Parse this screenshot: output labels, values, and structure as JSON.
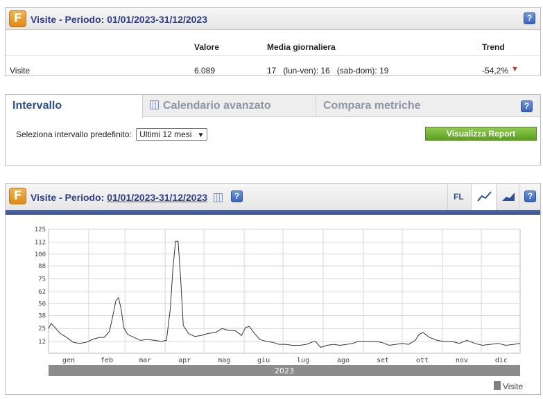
{
  "summary": {
    "logo": "F",
    "title": "Visite - Periodo: 01/01/2023-31/12/2023",
    "help": "?",
    "headers": {
      "valore": "Valore",
      "media": "Media giornaliera",
      "trend": "Trend"
    },
    "row": {
      "label": "Visite",
      "valore": "6.089",
      "media": "17   (lun-ven): 16   (sab-dom): 19",
      "trend": "-54,2%",
      "trend_icon": "down-arrow-icon"
    }
  },
  "interval": {
    "tabs": [
      "Intervallo",
      "Calendario avanzato",
      "Compara metriche"
    ],
    "help": "?",
    "select_label": "Seleziona intervallo predefinito:",
    "select_value": "Ultimi 12 mesi",
    "button": "Visualizza Report"
  },
  "chart_panel": {
    "logo": "F",
    "title_prefix": "Visite - Periodo:",
    "title_period": "01/01/2023-31/12/2023",
    "toolbar": {
      "fl": "FL",
      "line_icon": "line-chart-icon",
      "area_icon": "area-chart-icon",
      "help": "?"
    },
    "colors": {
      "line": "#333333",
      "year_bar": "#8c8c8c",
      "legend": "#808080"
    }
  },
  "chart_data": {
    "type": "line",
    "y_ticks": [
      12,
      25,
      38,
      50,
      62,
      75,
      88,
      100,
      112,
      125
    ],
    "ylim": [
      0,
      125
    ],
    "x_labels": [
      "gen",
      "feb",
      "mar",
      "apr",
      "mag",
      "giu",
      "lug",
      "ago",
      "set",
      "ott",
      "nov",
      "dic"
    ],
    "year_label": "2023",
    "grid": true,
    "legend": "bottom-right",
    "series": [
      {
        "name": "Visite",
        "points": [
          [
            "2023-01-01",
            25
          ],
          [
            "2023-01-03",
            30
          ],
          [
            "2023-01-06",
            26
          ],
          [
            "2023-01-10",
            20
          ],
          [
            "2023-01-15",
            16
          ],
          [
            "2023-01-20",
            11
          ],
          [
            "2023-01-25",
            10
          ],
          [
            "2023-01-30",
            11
          ],
          [
            "2023-02-04",
            14
          ],
          [
            "2023-02-09",
            16
          ],
          [
            "2023-02-13",
            16
          ],
          [
            "2023-02-17",
            22
          ],
          [
            "2023-02-20",
            40
          ],
          [
            "2023-02-22",
            53
          ],
          [
            "2023-02-24",
            56
          ],
          [
            "2023-02-26",
            45
          ],
          [
            "2023-02-28",
            26
          ],
          [
            "2023-03-03",
            19
          ],
          [
            "2023-03-08",
            16
          ],
          [
            "2023-03-13",
            13
          ],
          [
            "2023-03-18",
            14
          ],
          [
            "2023-03-24",
            13
          ],
          [
            "2023-03-29",
            12
          ],
          [
            "2023-04-02",
            13
          ],
          [
            "2023-04-05",
            45
          ],
          [
            "2023-04-07",
            85
          ],
          [
            "2023-04-09",
            113
          ],
          [
            "2023-04-11",
            113
          ],
          [
            "2023-04-13",
            75
          ],
          [
            "2023-04-15",
            28
          ],
          [
            "2023-04-19",
            20
          ],
          [
            "2023-04-24",
            17
          ],
          [
            "2023-04-29",
            18
          ],
          [
            "2023-05-04",
            20
          ],
          [
            "2023-05-10",
            21
          ],
          [
            "2023-05-15",
            25
          ],
          [
            "2023-05-20",
            23
          ],
          [
            "2023-05-25",
            23
          ],
          [
            "2023-05-30",
            18
          ],
          [
            "2023-06-02",
            26
          ],
          [
            "2023-06-05",
            27
          ],
          [
            "2023-06-09",
            20
          ],
          [
            "2023-06-13",
            14
          ],
          [
            "2023-06-18",
            12
          ],
          [
            "2023-06-23",
            11
          ],
          [
            "2023-06-28",
            9
          ],
          [
            "2023-07-03",
            9
          ],
          [
            "2023-07-08",
            8
          ],
          [
            "2023-07-14",
            8
          ],
          [
            "2023-07-19",
            9
          ],
          [
            "2023-07-23",
            11
          ],
          [
            "2023-07-26",
            12
          ],
          [
            "2023-07-30",
            6
          ],
          [
            "2023-08-04",
            8
          ],
          [
            "2023-08-09",
            9
          ],
          [
            "2023-08-14",
            8
          ],
          [
            "2023-08-19",
            9
          ],
          [
            "2023-08-24",
            10
          ],
          [
            "2023-08-28",
            12
          ],
          [
            "2023-09-03",
            12
          ],
          [
            "2023-09-09",
            12
          ],
          [
            "2023-09-15",
            11
          ],
          [
            "2023-09-21",
            8
          ],
          [
            "2023-09-26",
            9
          ],
          [
            "2023-10-01",
            10
          ],
          [
            "2023-10-06",
            9
          ],
          [
            "2023-10-11",
            13
          ],
          [
            "2023-10-14",
            19
          ],
          [
            "2023-10-17",
            21
          ],
          [
            "2023-10-22",
            16
          ],
          [
            "2023-10-28",
            13
          ],
          [
            "2023-11-02",
            12
          ],
          [
            "2023-11-08",
            12
          ],
          [
            "2023-11-14",
            10
          ],
          [
            "2023-11-20",
            13
          ],
          [
            "2023-11-26",
            10
          ],
          [
            "2023-12-02",
            8
          ],
          [
            "2023-12-08",
            9
          ],
          [
            "2023-12-14",
            10
          ],
          [
            "2023-12-20",
            8
          ],
          [
            "2023-12-26",
            9
          ],
          [
            "2023-12-31",
            10
          ]
        ]
      }
    ]
  }
}
